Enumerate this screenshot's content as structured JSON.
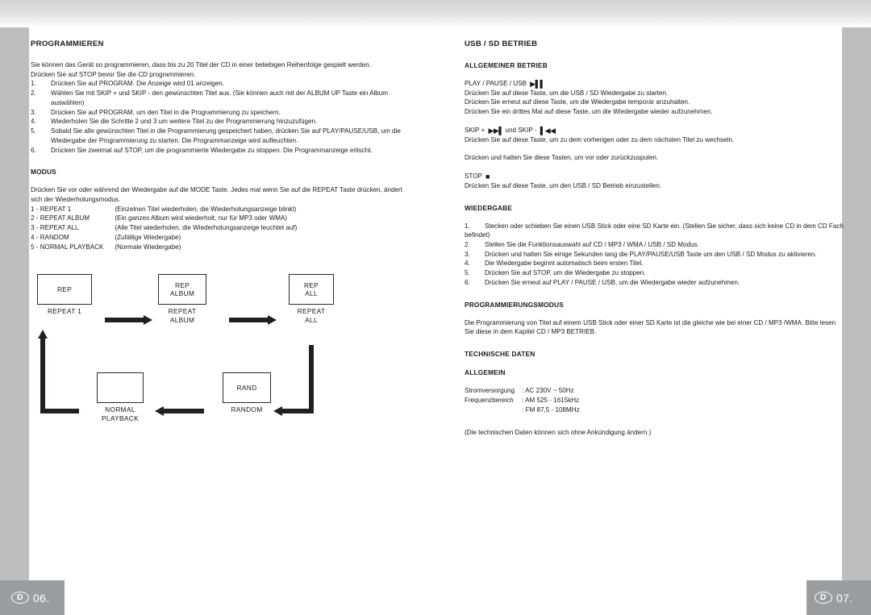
{
  "page_chrome": {
    "footer_left": {
      "lang": "D",
      "page": "06."
    },
    "footer_right": {
      "lang": "D",
      "page": "07."
    }
  },
  "left_page": {
    "title": "PROGRAMMIEREN",
    "intro": [
      "Sie können das Gerät so programmieren, dass bis zu 20 Titel der CD in einer beliebigen Reihenfolge gespielt werden.",
      "Drücken Sie auf STOP bevor Sie die CD programmieren."
    ],
    "steps": [
      {
        "num": "1.",
        "text": "Drücken Sie auf PROGRAM. Die Anzeige wird 01 anzeigen."
      },
      {
        "num": "2.",
        "text": "Wählen Sie mit SKIP + und SKIP - den gewünschten Titel aus. (Sie können auch mit der ALBUM UP Taste ein Album auswählen)"
      },
      {
        "num": "3.",
        "text": "Drücken Sie auf PROGRAM, um den Titel in die Programmierung zu speichern."
      },
      {
        "num": "4.",
        "text": "Wiederholen Sie die Schritte 2 und 3 um weitere Titel zu der Programmierung hinzuzufügen."
      },
      {
        "num": "5.",
        "text": "Sobald Sie alle gewünschten Titel in die Programmierung gespeichert haben, drücken Sie auf PLAY/PAUSE/USB, um die Wiedergabe der Programmierung zu starten. Die Programmanzeige wird aufleuchten."
      },
      {
        "num": "6.",
        "text": "Drücken Sie zweimal auf STOP, um die programmierte Wiedergabe zu stoppen. Die Programmanzeige erlischt."
      }
    ],
    "modus": {
      "title": "MODUS",
      "intro": "Drücken Sie vor oder während der Wiedergabe auf die MODE Taste. Jedes mal wenn Sie auf die REPEAT Taste drücken, ändert sich der Wiederholungsmodus.",
      "modes": [
        {
          "name": "1 - REPEAT 1",
          "desc": "(Einzelnen Titel wiederholen, die Wiederholungsanzeige blinkt)"
        },
        {
          "name": "2 - REPEAT ALBUM",
          "desc": "(Ein ganzes Album wird wiederholt, nur für MP3 oder WMA)"
        },
        {
          "name": "3 - REPEAT ALL",
          "desc": "(Alle Titel wiederholen, die Wiederholungsanzeige leuchtet auf)"
        },
        {
          "name": "4 - RANDOM",
          "desc": "(Zufällige Wiedergabe)"
        },
        {
          "name": "5 - NORMAL PLAYBACK",
          "desc": "(Normale Wiedergabe)"
        }
      ]
    },
    "diagram": {
      "nodes": [
        {
          "display": "REP",
          "caption": "REPEAT 1"
        },
        {
          "display": "REP\nALBUM",
          "caption": "REPEAT\nALBUM"
        },
        {
          "display": "REP\nALL",
          "caption": "REPEAT\nALL"
        },
        {
          "display": "RAND",
          "caption": "RANDOM"
        },
        {
          "display": "",
          "caption": "NORMAL\nPLAYBACK"
        }
      ],
      "node_display": {
        "rep": "REP",
        "rep_album_1": "REP",
        "rep_album_2": "ALBUM",
        "rep_all_1": "REP",
        "rep_all_2": "ALL",
        "rand": "RAND",
        "normal": ""
      },
      "node_caption": {
        "repeat_1": "REPEAT 1",
        "repeat_album_1": "REPEAT",
        "repeat_album_2": "ALBUM",
        "repeat_all_1": "REPEAT",
        "repeat_all_2": "ALL",
        "random": "RANDOM",
        "normal_1": "NORMAL",
        "normal_2": "PLAYBACK"
      }
    }
  },
  "right_page": {
    "title": "USB / SD BETRIEB",
    "general": {
      "title": "ALLGEMEINER BETRIEB",
      "play_label": "PLAY / PAUSE / USB",
      "play_icon": "play-pause-icon",
      "play_lines": [
        "Drücken Sie auf diese Taste, um die USB / SD Wiedergabe zu starten.",
        "Drücken Sie erneut auf diese Taste, um die Wiedergabe temporär anzuhalten.",
        "Drücken Sie ein drittes Mal auf diese Taste, um die Wiedergabe wieder aufzunehmen."
      ],
      "skip_label_a": "SKIP +",
      "skip_icon_next": "skip-forward-icon",
      "skip_label_b": "und SKIP -",
      "skip_icon_prev": "skip-back-icon",
      "skip_lines": [
        "Drücken Sie auf diese Taste, um zu dem vorherigen oder zu dem nächsten Titel zu wechseln.",
        "Drücken und halten Sie diese Tasten, um vor oder zurückzuspulen."
      ],
      "stop_label": "STOP",
      "stop_icon": "stop-icon",
      "stop_lines": [
        "Drücken Sie auf diese Taste, um den USB / SD Betrieb einzustellen."
      ]
    },
    "playback": {
      "title": "WIEDERGABE",
      "steps": [
        {
          "num": "1.",
          "text": "Stecken oder schieben Sie einen USB Stick oder eine SD Karte ein. (Stellen Sie sicher, dass sich keine CD in dem CD Fach befindet)"
        },
        {
          "num": "2.",
          "text": "Stellen Sie die Funktionsauswahl auf CD / MP3 / WMA / USB / SD Modus."
        },
        {
          "num": "3.",
          "text": "Drücken und halten Sie einige Sekunden lang die PLAY/PAUSE/USB Taste um den USB / SD Modus zu aktivieren."
        },
        {
          "num": "4.",
          "text": "Die Wiedergabe beginnt automatisch beim ersten Titel."
        },
        {
          "num": "5.",
          "text": "Drücken Sie auf STOP, um die Wiedergabe zu stoppen."
        },
        {
          "num": "6.",
          "text": "Drücken Sie erneut auf PLAY / PAUSE / USB, um die Wiedergabe wieder aufzunehmen."
        }
      ]
    },
    "program_mode": {
      "title": "PROGRAMMIERUNGSMODUS",
      "text": "Die Programmierung von Titel auf einem USB Stick oder einer SD Karte ist die gleiche wie bei einer CD / MP3 /WMA. Bitte lesen Sie diese in dem Kapitel CD / MP3 BETRIEB."
    },
    "specs": {
      "title": "TECHNISCHE DATEN",
      "subtitle": "ALLGEMEIN",
      "rows": [
        {
          "label": "Stromversorgung",
          "value": ": AC 230V ~ 50Hz"
        },
        {
          "label": "Frequenzbereich",
          "value": ": AM 525 - 1615kHz"
        },
        {
          "label": "",
          "value": ": FM 87,5 - 108MHz"
        }
      ],
      "note": "(Die technischen Daten können sich ohne Ankündigung ändern.)"
    }
  }
}
